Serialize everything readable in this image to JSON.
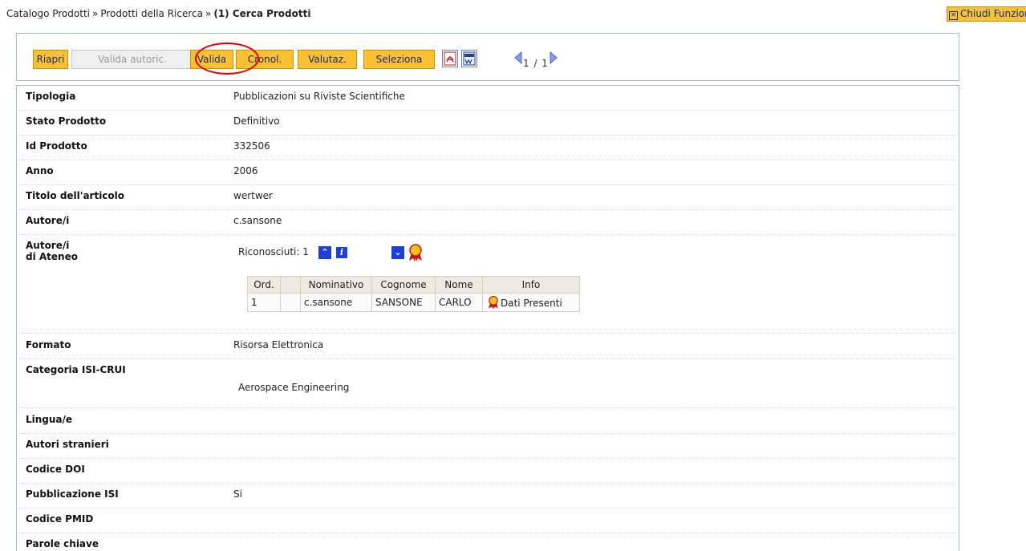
{
  "breadcrumb": {
    "item1": "Catalogo Prodotti",
    "item2": "Prodotti della Ricerca",
    "separator": "»",
    "current": "(1) Cerca Prodotti"
  },
  "close_function": {
    "label": "Chiudi Funzione",
    "icon": "close-box-icon"
  },
  "toolbar": {
    "riapri": "Riapri",
    "valida_autoric": "Valida autoric.",
    "valida": "Valida",
    "cronol": "Cronol.",
    "valutaz": "Valutaz.",
    "seleziona": "Seleziona",
    "pdf_icon": "pdf-icon",
    "word_icon": "word-icon",
    "pager": "1 / 1"
  },
  "fields": [
    {
      "label": "Tipologia",
      "value": "Pubblicazioni su Riviste Scientifiche"
    },
    {
      "label": "Stato Prodotto",
      "value": "Definitivo"
    },
    {
      "label": "Id Prodotto",
      "value": "332506"
    },
    {
      "label": "Anno",
      "value": "2006"
    },
    {
      "label": "Titolo dell'articolo",
      "value": "wertwer"
    },
    {
      "label": "Autore/i",
      "value": "c.sansone"
    },
    {
      "label": "Autore/i di Ateneo",
      "label_line1": "Autore/i",
      "label_line2": "di Ateneo",
      "value": ""
    },
    {
      "label": "Formato",
      "value": "Risorsa Elettronica"
    },
    {
      "label": "Categoria ISI-CRUI",
      "value": "Aerospace Engineering"
    },
    {
      "label": "Lingua/e",
      "value": ""
    },
    {
      "label": "Autori stranieri",
      "value": ""
    },
    {
      "label": "Codice DOI",
      "value": ""
    },
    {
      "label": "Pubblicazione ISI",
      "value": "Si"
    },
    {
      "label": "Codice PMID",
      "value": ""
    },
    {
      "label": "Parole chiave",
      "value": ""
    }
  ],
  "ateneo": {
    "riconosciuti_label": "Riconosciuti: 1",
    "table_headers": [
      "Ord.",
      "",
      "Nominativo",
      "Cognome",
      "Nome",
      "Info"
    ],
    "rows": [
      {
        "ord": "1",
        "blank": "",
        "nominativo": "c.sansone",
        "cognome": "SANSONE",
        "nome": "CARLO",
        "info": "Dati Presenti"
      }
    ]
  },
  "colors": {
    "button_bg": "#f9c031",
    "button_border": "#c79000",
    "button_text": "#1a2c7a",
    "frame": "#9fbdd8",
    "highlight": "#e00000"
  }
}
